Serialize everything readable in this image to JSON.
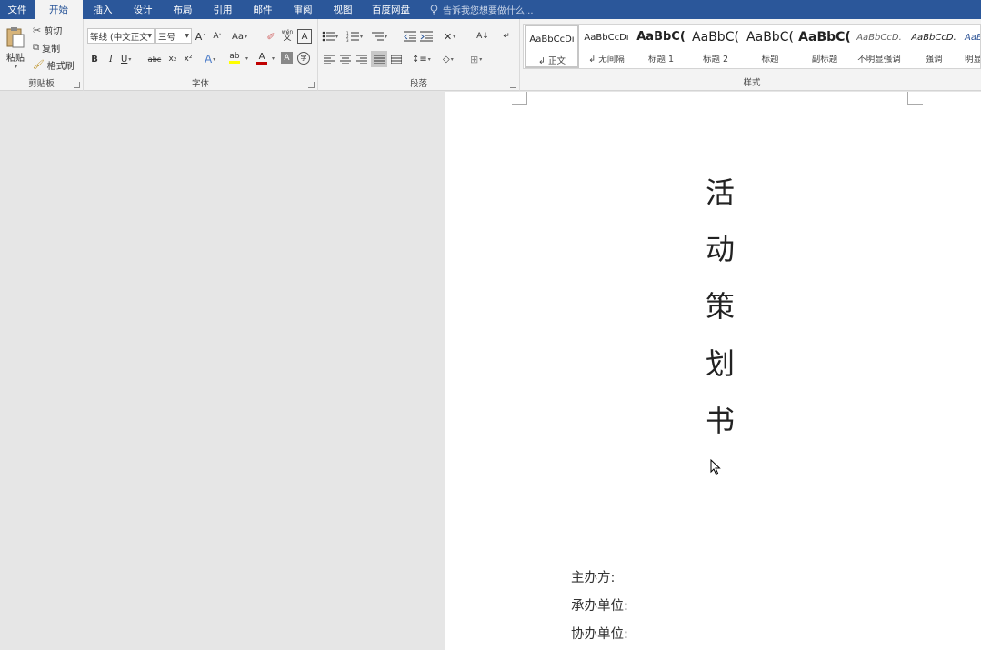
{
  "tabs": [
    {
      "label": "文件",
      "active": false
    },
    {
      "label": "开始",
      "active": true
    },
    {
      "label": "插入",
      "active": false
    },
    {
      "label": "设计",
      "active": false
    },
    {
      "label": "布局",
      "active": false
    },
    {
      "label": "引用",
      "active": false
    },
    {
      "label": "邮件",
      "active": false
    },
    {
      "label": "审阅",
      "active": false
    },
    {
      "label": "视图",
      "active": false
    },
    {
      "label": "百度网盘",
      "active": false
    }
  ],
  "tellme": {
    "placeholder": "告诉我您想要做什么..."
  },
  "clipboard": {
    "paste_label": "粘贴",
    "cut_label": "剪切",
    "copy_label": "复制",
    "format_painter_label": "格式刷",
    "group_label": "剪贴板"
  },
  "font": {
    "font_name": "等线 (中文正文",
    "font_size": "三号",
    "group_label": "字体",
    "change_case_label": "Aa",
    "bold": "B",
    "italic": "I",
    "underline": "U",
    "strikethrough": "abc",
    "subscript": "x₂",
    "superscript": "x²",
    "grow": "A",
    "shrink": "A",
    "phonetic": "wén",
    "char_border": "A",
    "text_effects": "A",
    "highlight": "ab",
    "font_color": "A",
    "char_shading": "A",
    "enclose": "字"
  },
  "paragraph": {
    "group_label": "段落"
  },
  "styles": {
    "group_label": "样式",
    "items": [
      {
        "sample": "AaBbCcDı",
        "name": "↲ 正文",
        "selected": true
      },
      {
        "sample": "AaBbCcDı",
        "name": "↲ 无间隔",
        "selected": false
      },
      {
        "sample": "AaBbC(",
        "name": "标题 1",
        "selected": false
      },
      {
        "sample": "AaBbC(",
        "name": "标题 2",
        "selected": false
      },
      {
        "sample": "AaBbC(",
        "name": "标题",
        "selected": false
      },
      {
        "sample": "AaBbC(",
        "name": "副标题",
        "selected": false
      },
      {
        "sample": "AaBbCcD.",
        "name": "不明显强调",
        "selected": false
      },
      {
        "sample": "AaBbCcD.",
        "name": "强调",
        "selected": false
      },
      {
        "sample": "AaB",
        "name": "明显",
        "selected": false
      }
    ]
  },
  "document": {
    "title_chars": [
      "活",
      "动",
      "策",
      "划",
      "书"
    ],
    "info_lines": [
      "主办方:",
      "承办单位:",
      "协办单位:"
    ]
  },
  "colors": {
    "tabbar": "#2b579a",
    "ribbon": "#f3f3f3",
    "workspace": "#e6e6e6",
    "font_color_bar": "#c00000",
    "highlight_bar": "#ffff00"
  }
}
